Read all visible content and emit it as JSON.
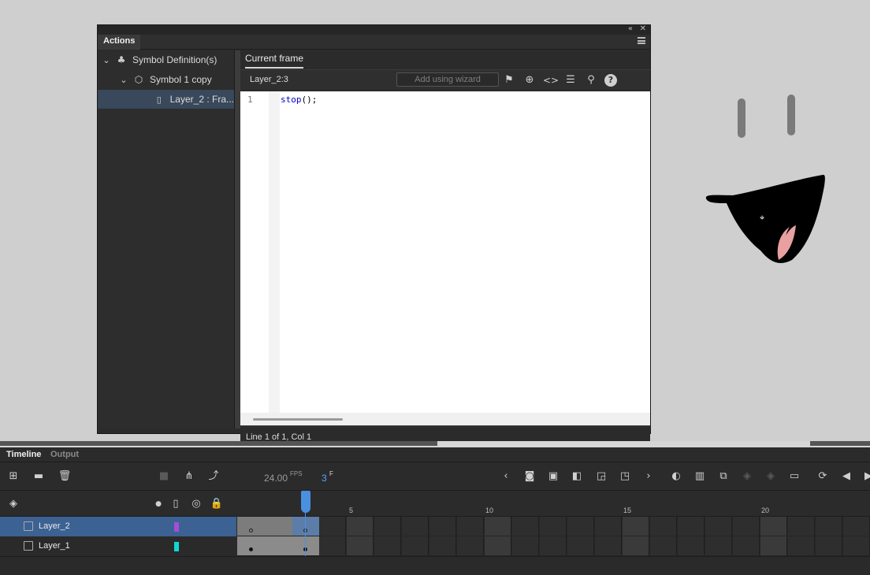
{
  "actions_panel": {
    "tab_title": "Actions",
    "collapse_icon": "double-chevron-left-icon",
    "close_icon": "close-icon",
    "tree": [
      {
        "label": "Symbol Definition(s)",
        "icon": "club-icon"
      },
      {
        "label": "Symbol 1 copy",
        "icon": "symbol-icon"
      },
      {
        "label": "Layer_2 : Fra..."
      }
    ],
    "editor_tab": "Current frame",
    "frame_label": "Layer_2:3",
    "wizard_placeholder": "Add using wizard",
    "code_lines": [
      {
        "num": "1",
        "keyword": "stop",
        "rest": "();"
      }
    ],
    "status": "Line 1 of 1, Col 1"
  },
  "timeline": {
    "tabs": [
      "Timeline",
      "Output"
    ],
    "fps": "24.00",
    "fps_unit": "FPS",
    "current_frame": "3",
    "frame_unit": "F",
    "ruler_numbers": [
      "5",
      "10",
      "15",
      "20"
    ],
    "layers": [
      {
        "name": "Layer_2",
        "color": "#a64dd6",
        "selected": true
      },
      {
        "name": "Layer_1",
        "color": "#12d6d6",
        "selected": false
      }
    ]
  }
}
